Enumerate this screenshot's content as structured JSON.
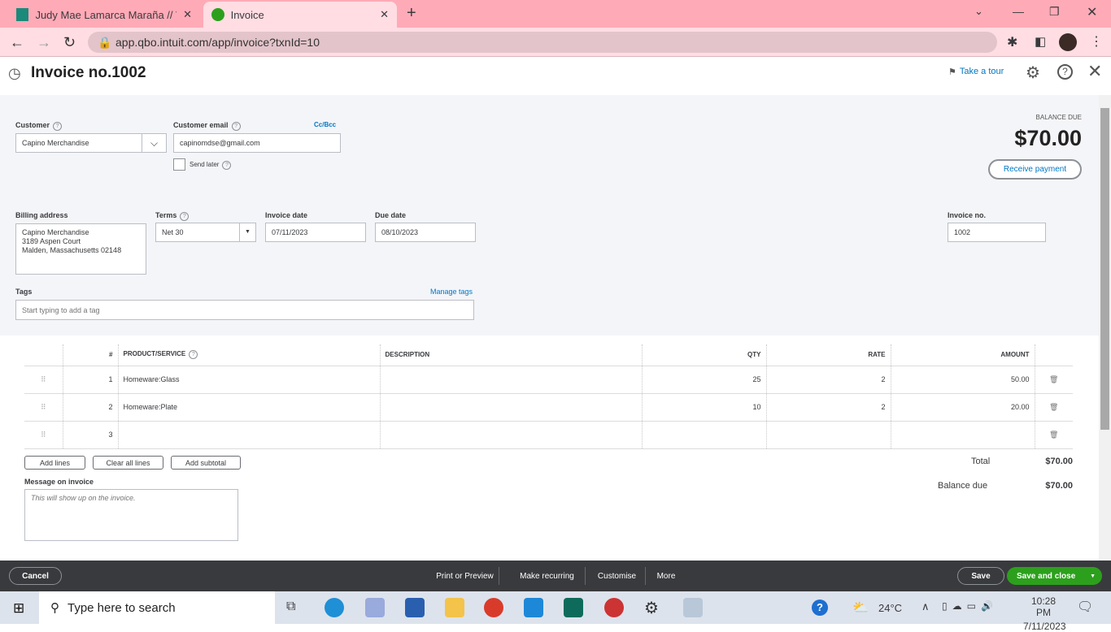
{
  "browser": {
    "tabs": [
      {
        "title": "Judy Mae Lamarca Maraña // Virt"
      },
      {
        "title": "Invoice"
      }
    ],
    "url": "app.qbo.intuit.com/app/invoice?txnId=10"
  },
  "header": {
    "title": "Invoice no.1002",
    "take_tour": "Take a tour"
  },
  "form": {
    "customer_label": "Customer",
    "customer_value": "Capino Merchandise",
    "email_label": "Customer email",
    "email_value": "capinomdse@gmail.com",
    "ccbcc": "Cc/Bcc",
    "send_later": "Send later",
    "send_later_checked": false,
    "balance_label": "BALANCE DUE",
    "balance_value": "$70.00",
    "receive_payment": "Receive payment",
    "billing_label": "Billing address",
    "billing_lines": [
      "Capino Merchandise",
      "3189 Aspen Court",
      "Malden, Massachusetts  02148"
    ],
    "terms_label": "Terms",
    "terms_value": "Net 30",
    "invoice_date_label": "Invoice date",
    "invoice_date": "07/11/2023",
    "due_date_label": "Due date",
    "due_date": "08/10/2023",
    "invoice_no_label": "Invoice no.",
    "invoice_no": "1002",
    "tags_label": "Tags",
    "manage_tags": "Manage tags",
    "tags_placeholder": "Start typing to add a tag"
  },
  "table": {
    "headers": [
      "#",
      "PRODUCT/SERVICE",
      "DESCRIPTION",
      "QTY",
      "RATE",
      "AMOUNT"
    ],
    "rows": [
      {
        "n": "1",
        "product": "Homeware:Glass",
        "description": "",
        "qty": "25",
        "rate": "2",
        "amount": "50.00"
      },
      {
        "n": "2",
        "product": "Homeware:Plate",
        "description": "",
        "qty": "10",
        "rate": "2",
        "amount": "20.00"
      },
      {
        "n": "3",
        "product": "",
        "description": "",
        "qty": "",
        "rate": "",
        "amount": ""
      }
    ],
    "add_lines": "Add lines",
    "clear_lines": "Clear all lines",
    "add_subtotal": "Add subtotal"
  },
  "totals": {
    "total_label": "Total",
    "total": "$70.00",
    "balance_label": "Balance due",
    "balance": "$70.00"
  },
  "message": {
    "label": "Message on invoice",
    "placeholder": "This will show up on the invoice."
  },
  "footer": {
    "cancel": "Cancel",
    "print": "Print or Preview",
    "recurring": "Make recurring",
    "customise": "Customise",
    "more": "More",
    "save": "Save",
    "save_close": "Save and close"
  },
  "taskbar": {
    "search": "Type here to search",
    "weather": "24°C",
    "time": "10:28 PM",
    "date": "7/11/2023"
  },
  "colors": {
    "accent": "#2ca01c",
    "link": "#0077c5",
    "tabbar": "#ffaab7"
  }
}
